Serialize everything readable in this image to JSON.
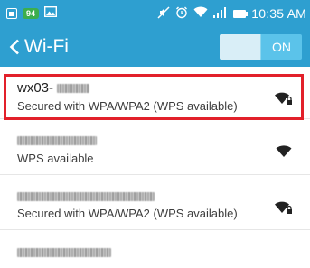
{
  "status_bar": {
    "notification_badge": "94",
    "time": "10:35 AM"
  },
  "action_bar": {
    "title": "Wi-Fi",
    "toggle_label": "ON"
  },
  "networks": [
    {
      "ssid": "wx03-",
      "status": "Secured with WPA/WPA2 (WPS available)",
      "locked": true,
      "selected": true
    },
    {
      "ssid": "",
      "status": "WPS available",
      "locked": false,
      "selected": false
    },
    {
      "ssid": "",
      "status": "Secured with WPA/WPA2 (WPS available)",
      "locked": true,
      "selected": false
    },
    {
      "ssid": "",
      "status": "",
      "locked": true,
      "selected": false
    }
  ],
  "colors": {
    "accent": "#2e9fd0",
    "toggle_on": "#5bc3ea",
    "highlight": "#e2202a"
  }
}
